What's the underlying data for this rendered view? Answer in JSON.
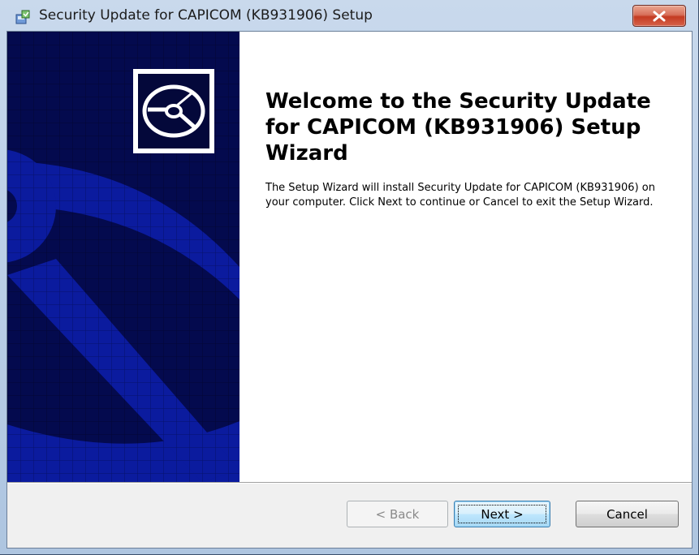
{
  "window": {
    "title": "Security Update for CAPICOM (KB931906) Setup",
    "close_icon": "close-x-icon"
  },
  "banner": {
    "icon": "cd-disc-icon",
    "background_color": "#040a4e",
    "art_color": "#0b1b9e"
  },
  "main": {
    "heading": "Welcome to the Security Update for CAPICOM (KB931906) Setup Wizard",
    "description": "The Setup Wizard will install Security Update for CAPICOM (KB931906) on your computer. Click Next to continue or Cancel to exit the Setup Wizard."
  },
  "buttons": {
    "back": {
      "label": "< Back",
      "enabled": false
    },
    "next": {
      "label": "Next >",
      "default": true
    },
    "cancel": {
      "label": "Cancel"
    }
  }
}
